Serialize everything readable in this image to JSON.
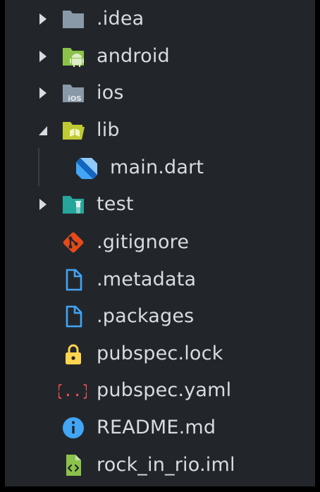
{
  "tree": {
    "items": [
      {
        "label": ".idea",
        "icon": "folder-icon",
        "type": "folder",
        "expanded": false,
        "color": "#8a99a8"
      },
      {
        "label": "android",
        "icon": "android-folder-icon",
        "type": "folder",
        "expanded": false,
        "color": "#8bc34a"
      },
      {
        "label": "ios",
        "icon": "ios-folder-icon",
        "type": "folder",
        "expanded": false,
        "color": "#8a99a8"
      },
      {
        "label": "lib",
        "icon": "lib-folder-open-icon",
        "type": "folder",
        "expanded": true,
        "color": "#c0ca33"
      },
      {
        "label": "main.dart",
        "icon": "dart-icon",
        "type": "file",
        "indent": 1,
        "color": "#42a5f5"
      },
      {
        "label": "test",
        "icon": "test-folder-icon",
        "type": "folder",
        "expanded": false,
        "color": "#26a69a"
      },
      {
        "label": ".gitignore",
        "icon": "git-icon",
        "type": "file",
        "color": "#e64a19"
      },
      {
        "label": ".metadata",
        "icon": "file-icon",
        "type": "file",
        "color": "#42a5f5"
      },
      {
        "label": ".packages",
        "icon": "file-icon",
        "type": "file",
        "color": "#42a5f5"
      },
      {
        "label": "pubspec.lock",
        "icon": "lock-icon",
        "type": "file",
        "color": "#ffd54f"
      },
      {
        "label": "pubspec.yaml",
        "icon": "yaml-braces-icon",
        "type": "file",
        "color": "#ff5252"
      },
      {
        "label": "README.md",
        "icon": "info-icon",
        "type": "file",
        "color": "#42a5f5"
      },
      {
        "label": "rock_in_rio.iml",
        "icon": "iml-file-icon",
        "type": "file",
        "color": "#8bc34a"
      }
    ]
  }
}
